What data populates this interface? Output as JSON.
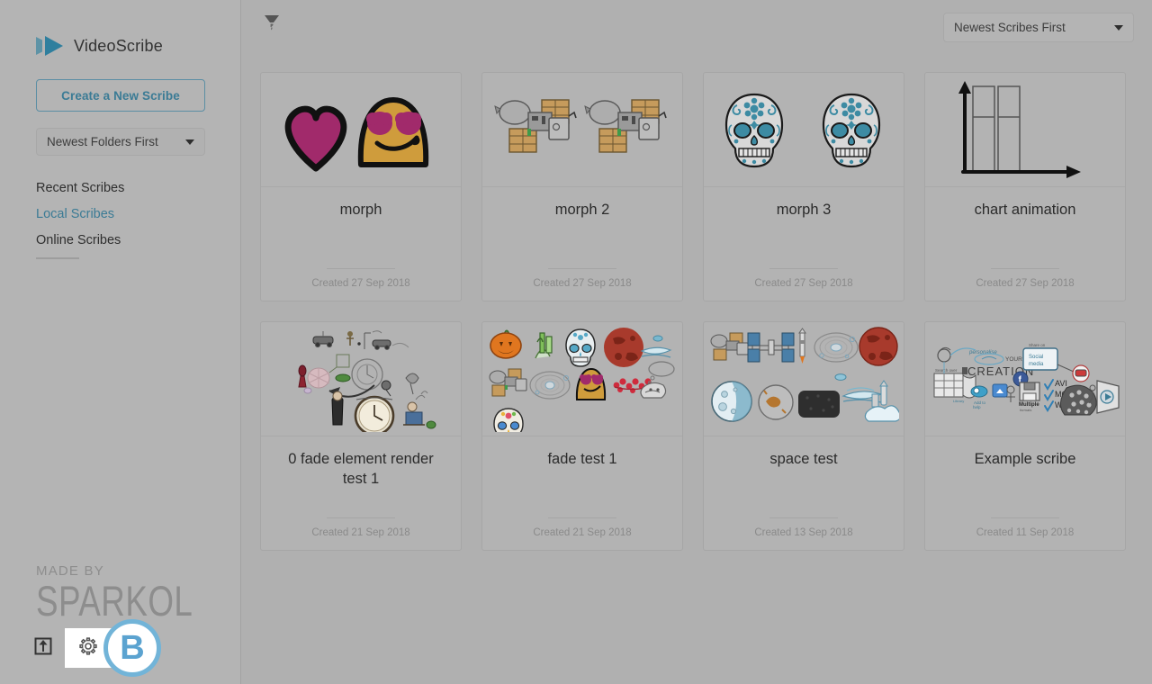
{
  "app": {
    "brand_name": "VideoScribe",
    "logo_icon": "play-triangle-logo",
    "accent_color": "#3b7b95",
    "sidebar_bg": "#b4b4b4",
    "main_bg": "#b0b0b0"
  },
  "sidebar": {
    "create_button_label": "Create a New Scribe",
    "folder_sort": {
      "selected": "Newest Folders First",
      "caret_icon": "chevron-down-icon"
    },
    "nav_items": [
      {
        "label": "Recent Scribes",
        "active": false
      },
      {
        "label": "Local Scribes",
        "active": true
      },
      {
        "label": "Online Scribes",
        "active": false
      }
    ],
    "footer": {
      "made_by": "MADE BY",
      "brand": "SPARKOL",
      "import_icon": "import-upload-icon",
      "settings_icon": "gear-icon"
    },
    "annotation_badge": {
      "letter": "B",
      "ring_color": "#72b4d8",
      "text_color": "#5ba3d0"
    }
  },
  "topbar": {
    "filter_icon": "filter-funnel-icon",
    "scribe_sort": {
      "selected": "Newest Scribes First",
      "caret_icon": "chevron-down-icon"
    }
  },
  "grid": {
    "cards": [
      {
        "title": "morph",
        "date": "Created 27 Sep 2018",
        "thumb_icon": "heart-and-smiley-thumbnail"
      },
      {
        "title": "morph 2",
        "date": "Created 27 Sep 2018",
        "thumb_icon": "two-satellites-thumbnail"
      },
      {
        "title": "morph 3",
        "date": "Created 27 Sep 2018",
        "thumb_icon": "two-sugar-skulls-thumbnail"
      },
      {
        "title": "chart animation",
        "date": "Created 27 Sep 2018",
        "thumb_icon": "bar-chart-axes-thumbnail"
      },
      {
        "title": "0 fade element render test 1",
        "date": "Created 21 Sep 2018",
        "thumb_icon": "scattered-sketch-elements-thumbnail"
      },
      {
        "title": "fade test 1",
        "date": "Created 21 Sep 2018",
        "thumb_icon": "mixed-icons-grid-thumbnail"
      },
      {
        "title": "space test",
        "date": "Created 13 Sep 2018",
        "thumb_icon": "space-objects-thumbnail"
      },
      {
        "title": "Example scribe",
        "date": "Created 11 Sep 2018",
        "thumb_icon": "whiteboard-creation-scene-thumbnail"
      }
    ]
  }
}
